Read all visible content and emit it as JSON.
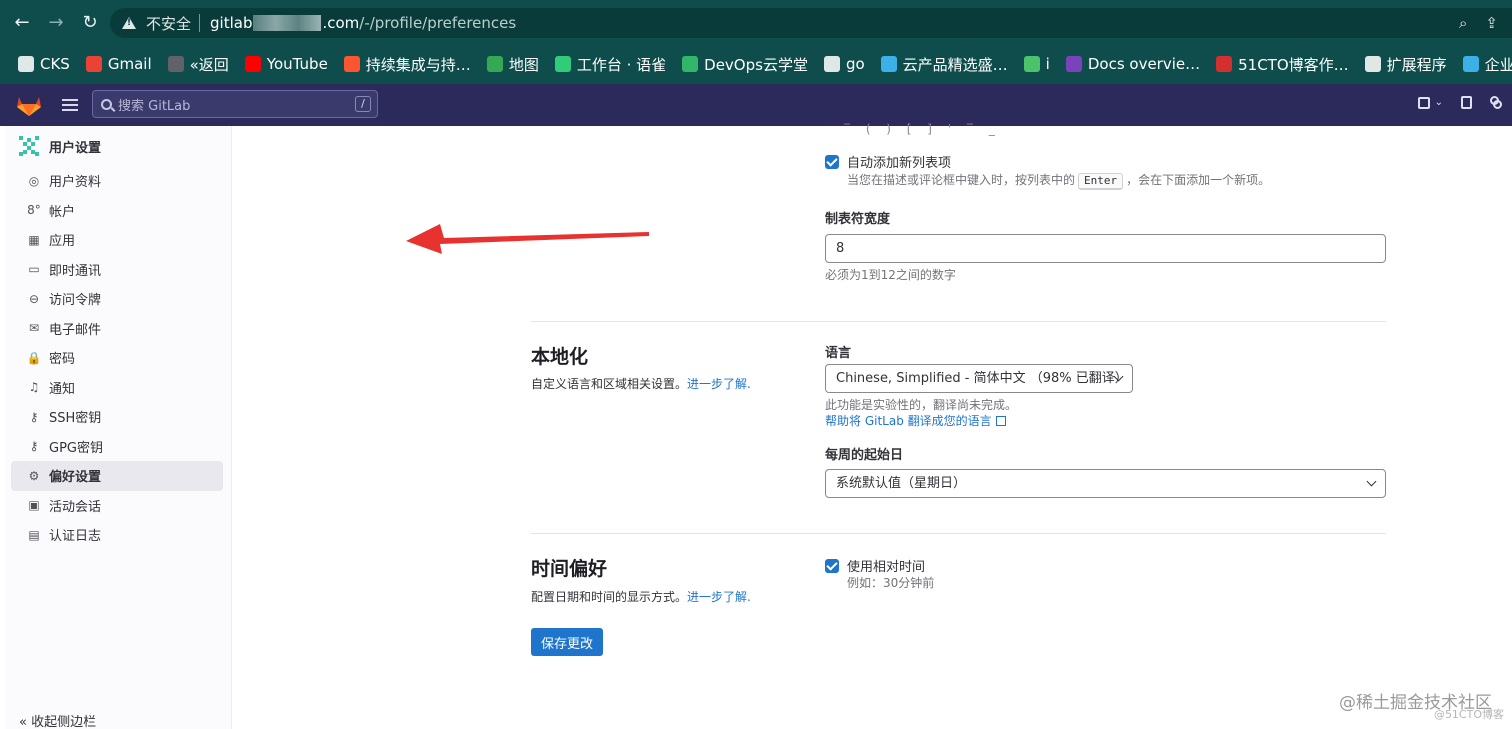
{
  "browser": {
    "insecure_label": "不安全",
    "url_prefix": "gitlab",
    "url_suffix": ".com",
    "url_path": "/-/profile/preferences",
    "bookmarks": [
      {
        "label": "CKS",
        "icon": "folder-icon",
        "color": "#dfe7e7"
      },
      {
        "label": "Gmail",
        "icon": "google-icon",
        "color": "#ea4335"
      },
      {
        "label": "«返回",
        "icon": "globe-icon",
        "color": "#5f6368"
      },
      {
        "label": "YouTube",
        "icon": "youtube-icon",
        "color": "#ff0000"
      },
      {
        "label": "持续集成与持…",
        "icon": "csdn-icon",
        "color": "#fc5531"
      },
      {
        "label": "地图",
        "icon": "map-icon",
        "color": "#34a853"
      },
      {
        "label": "工作台 · 语雀",
        "icon": "yuque-icon",
        "color": "#31cc79"
      },
      {
        "label": "DevOps云学堂",
        "icon": "leaf-icon",
        "color": "#31b66a"
      },
      {
        "label": "go",
        "icon": "folder-icon",
        "color": "#dfe7e7"
      },
      {
        "label": "云产品精选盛…",
        "icon": "cloud-icon",
        "color": "#3bb1e8"
      },
      {
        "label": "i",
        "icon": "s-icon",
        "color": "#4cc36a"
      },
      {
        "label": "Docs overvie…",
        "icon": "terraform-icon",
        "color": "#7b42bc"
      },
      {
        "label": "51CTO博客作…",
        "icon": "51cto-icon",
        "color": "#d32f2f"
      },
      {
        "label": "扩展程序",
        "icon": "puzzle-icon",
        "color": "#dfe7e7"
      },
      {
        "label": "企业",
        "icon": "cloud-icon",
        "color": "#3bb1e8"
      }
    ]
  },
  "header": {
    "search_placeholder": "搜索 GitLab",
    "search_shortcut": "/"
  },
  "sidebar": {
    "title": "用户设置",
    "items": [
      {
        "label": "用户资料",
        "icon": "profile-icon",
        "glyph": "◎"
      },
      {
        "label": "帐户",
        "icon": "account-icon",
        "glyph": "8°"
      },
      {
        "label": "应用",
        "icon": "applications-icon",
        "glyph": "▦"
      },
      {
        "label": "即时通讯",
        "icon": "chat-icon",
        "glyph": "▭"
      },
      {
        "label": "访问令牌",
        "icon": "token-icon",
        "glyph": "⊖"
      },
      {
        "label": "电子邮件",
        "icon": "email-icon",
        "glyph": "✉"
      },
      {
        "label": "密码",
        "icon": "lock-icon",
        "glyph": "🔒"
      },
      {
        "label": "通知",
        "icon": "bell-icon",
        "glyph": "♫"
      },
      {
        "label": "SSH密钥",
        "icon": "key-icon",
        "glyph": "⚷"
      },
      {
        "label": "GPG密钥",
        "icon": "key-icon",
        "glyph": "⚷"
      },
      {
        "label": "偏好设置",
        "icon": "preferences-icon",
        "glyph": "⚙",
        "active": true
      },
      {
        "label": "活动会话",
        "icon": "monitor-icon",
        "glyph": "▣"
      },
      {
        "label": "认证日志",
        "icon": "log-icon",
        "glyph": "▤"
      }
    ],
    "collapse_label": "« 收起侧边栏"
  },
  "behavior": {
    "auto_list_label": "自动添加新列表项",
    "auto_list_checked": true,
    "auto_list_help_prefix": "当您在描述或评论框中键入时，按列表中的",
    "auto_list_help_key": "Enter",
    "auto_list_help_suffix": "，会在下面添加一个新项。",
    "tab_width_label": "制表符宽度",
    "tab_width_value": "8",
    "tab_width_help": "必须为1到12之间的数字"
  },
  "localization": {
    "title": "本地化",
    "desc": "自定义语言和区域相关设置。",
    "learn_more": "进一步了解.",
    "language_label": "语言",
    "language_value": "Chinese, Simplified - 简体中文 （98% 已翻译）",
    "language_help": "此功能是实验性的，翻译尚未完成。",
    "translate_link": "帮助将 GitLab 翻译成您的语言",
    "first_day_label": "每周的起始日",
    "first_day_value": "系统默认值（星期日）"
  },
  "time": {
    "title": "时间偏好",
    "desc": "配置日期和时间的显示方式。",
    "learn_more": "进一步了解.",
    "relative_label": "使用相对时间",
    "relative_checked": true,
    "relative_help": "例如：30分钟前"
  },
  "save_label": "保存更改",
  "watermark": "@稀土掘金技术社区",
  "watermark_sub": "@51CTO博客",
  "colors": {
    "brand_header": "#2b2a5a",
    "browser_chrome": "#0f4d4d",
    "primary": "#1f75cb",
    "arrow": "#e8322f"
  }
}
